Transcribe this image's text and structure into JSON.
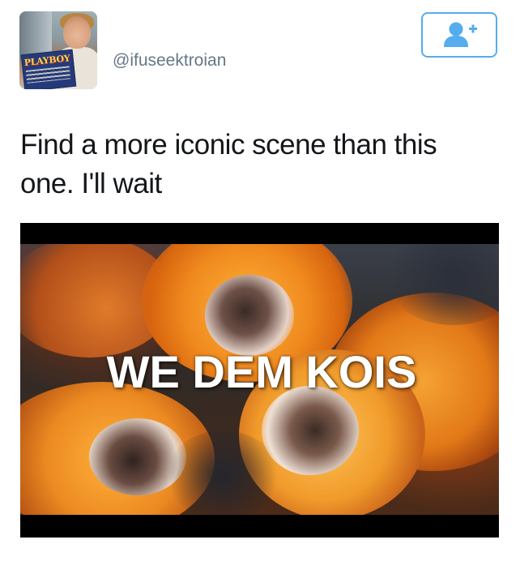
{
  "tweet": {
    "handle": "@ifuseektroian",
    "text_line1": "Find a more iconic scene than this",
    "text_line2": "one. I'll wait",
    "avatar_magazine_text": "PLAYBOY"
  },
  "follow_button": {
    "icon": "add-user-icon",
    "color": "#55acee"
  },
  "media": {
    "caption": "WE DEM KOIS"
  },
  "colors": {
    "handle": "#657786",
    "text": "#14171a",
    "accent": "#55acee"
  }
}
